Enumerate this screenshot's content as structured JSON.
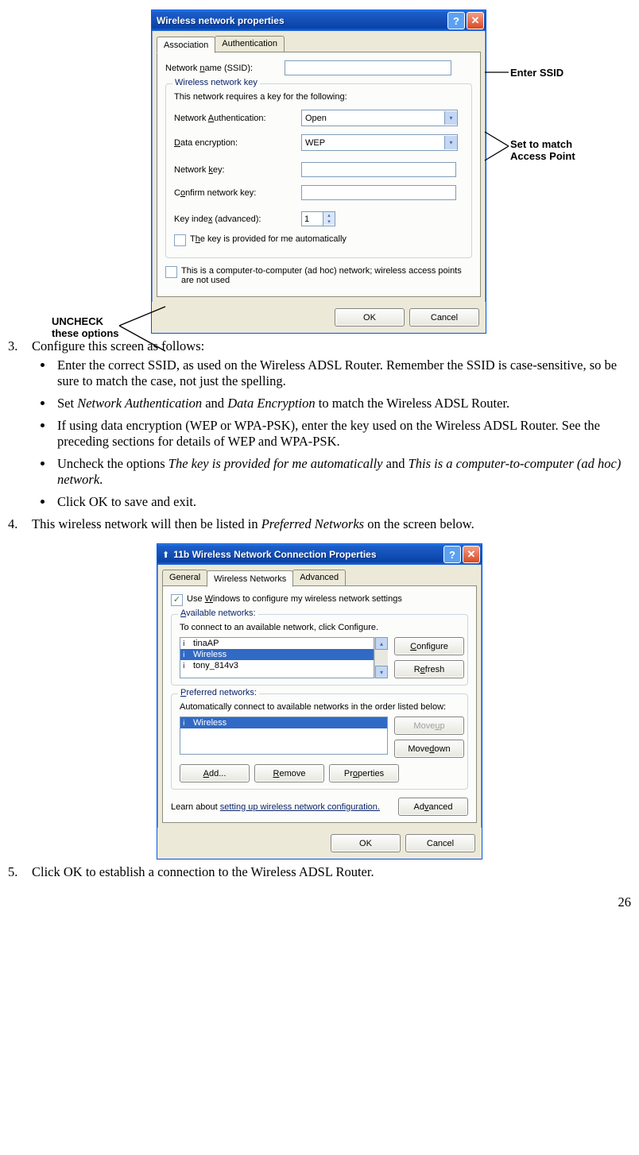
{
  "page_number": "26",
  "callouts": {
    "uncheck": "UNCHECK\nthese options",
    "enter_ssid": "Enter SSID",
    "set_match": "Set to match\nAccess Point"
  },
  "dialog1": {
    "title": "Wireless network properties",
    "tabs": {
      "assoc": "Association",
      "auth": "Authentication"
    },
    "ssid_label": "Network name (SSID):",
    "ssid_value": "",
    "group_key": "Wireless network key",
    "key_desc": "This network requires a key for the following:",
    "auth_label": "Network Authentication:",
    "auth_value": "Open",
    "enc_label": "Data encryption:",
    "enc_value": "WEP",
    "netkey_label": "Network key:",
    "confkey_label": "Confirm network key:",
    "keyidx_label": "Key index (advanced):",
    "keyidx_value": "1",
    "cb_auto": "The key is provided for me automatically",
    "cb_adhoc": "This is a computer-to-computer (ad hoc) network; wireless access points are not used",
    "ok": "OK",
    "cancel": "Cancel"
  },
  "instr": {
    "step3_intro": "Configure this screen as follows:",
    "b1a": "Enter the correct SSID, as used on the Wireless ADSL Router. Remember the SSID is case-sensitive, so be sure to match the case, not just the spelling.",
    "b2a": "Set ",
    "b2b": "Network Authentication",
    "b2c": " and ",
    "b2d": "Data Encryption",
    "b2e": " to match the Wireless ADSL Router.",
    "b3a": "If using data encryption (WEP or WPA-PSK), enter the key used on the Wireless ADSL Router. See the preceding sections for details of WEP and WPA-PSK.",
    "b4a": "Uncheck the options ",
    "b4b": "The key is provided for me automatically",
    "b4c": " and ",
    "b4d": "This is a computer-to-computer (ad hoc) network",
    "b4e": ".",
    "b5a": "Click OK to save and exit.",
    "step4a": "This wireless network will then be listed in ",
    "step4b": "Preferred Networks",
    "step4c": " on the screen below.",
    "step5": "Click OK to establish a connection to the Wireless ADSL Router."
  },
  "dialog2": {
    "title": "11b Wireless Network Connection Properties",
    "tabs": {
      "gen": "General",
      "wnet": "Wireless Networks",
      "adv": "Advanced"
    },
    "cb_usewin": "Use Windows to configure my wireless network settings",
    "avail_legend": "Available networks:",
    "avail_desc": "To connect to an available network, click Configure.",
    "avail_items": [
      "tinaAP",
      "Wireless",
      "tony_814v3"
    ],
    "configure": "Configure",
    "refresh": "Refresh",
    "pref_legend": "Preferred networks:",
    "pref_desc": "Automatically connect to available networks in the order listed below:",
    "pref_items": [
      "Wireless"
    ],
    "moveup": "Move up",
    "movedown": "Move down",
    "add": "Add...",
    "remove": "Remove",
    "properties": "Properties",
    "learn_a": "Learn about ",
    "learn_link": "setting up wireless network configuration.",
    "advanced": "Advanced",
    "ok": "OK",
    "cancel": "Cancel"
  }
}
